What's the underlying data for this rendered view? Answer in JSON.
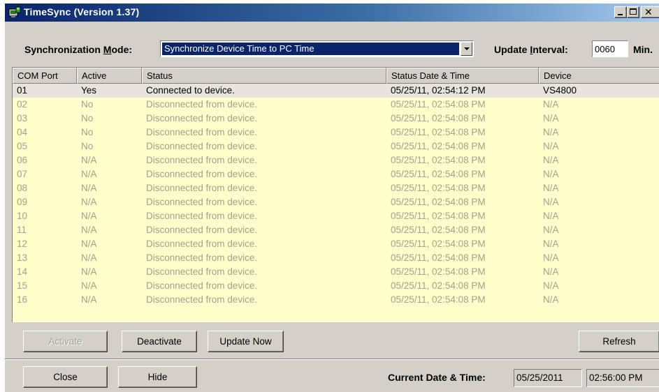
{
  "window": {
    "title": "TimeSync (Version 1.37)",
    "icon": "timesync-app-icon"
  },
  "sync_mode": {
    "label_prefix": "Synchronization ",
    "label_accel": "M",
    "label_suffix": "ode:",
    "value": "Synchronize Device Time to PC Time"
  },
  "update_interval": {
    "label_prefix": "Update ",
    "label_accel": "I",
    "label_suffix": "nterval:",
    "value": "0060",
    "unit": "Min."
  },
  "table": {
    "columns": [
      "COM Port",
      "Active",
      "Status",
      "Status Date & Time",
      "Device"
    ],
    "rows": [
      {
        "port": "01",
        "active": "Yes",
        "status": "Connected to device.",
        "datetime": "05/25/11, 02:54:12 PM",
        "device": "VS4800",
        "state": "active"
      },
      {
        "port": "02",
        "active": "No",
        "status": "Disconnected from device.",
        "datetime": "05/25/11, 02:54:08 PM",
        "device": "N/A",
        "state": "inactive"
      },
      {
        "port": "03",
        "active": "No",
        "status": "Disconnected from device.",
        "datetime": "05/25/11, 02:54:08 PM",
        "device": "N/A",
        "state": "inactive"
      },
      {
        "port": "04",
        "active": "No",
        "status": "Disconnected from device.",
        "datetime": "05/25/11, 02:54:08 PM",
        "device": "N/A",
        "state": "inactive"
      },
      {
        "port": "05",
        "active": "No",
        "status": "Disconnected from device.",
        "datetime": "05/25/11, 02:54:08 PM",
        "device": "N/A",
        "state": "inactive"
      },
      {
        "port": "06",
        "active": "N/A",
        "status": "Disconnected from device.",
        "datetime": "05/25/11, 02:54:08 PM",
        "device": "N/A",
        "state": "inactive"
      },
      {
        "port": "07",
        "active": "N/A",
        "status": "Disconnected from device.",
        "datetime": "05/25/11, 02:54:08 PM",
        "device": "N/A",
        "state": "inactive"
      },
      {
        "port": "08",
        "active": "N/A",
        "status": "Disconnected from device.",
        "datetime": "05/25/11, 02:54:08 PM",
        "device": "N/A",
        "state": "inactive"
      },
      {
        "port": "09",
        "active": "N/A",
        "status": "Disconnected from device.",
        "datetime": "05/25/11, 02:54:08 PM",
        "device": "N/A",
        "state": "inactive"
      },
      {
        "port": "10",
        "active": "N/A",
        "status": "Disconnected from device.",
        "datetime": "05/25/11, 02:54:08 PM",
        "device": "N/A",
        "state": "inactive"
      },
      {
        "port": "11",
        "active": "N/A",
        "status": "Disconnected from device.",
        "datetime": "05/25/11, 02:54:08 PM",
        "device": "N/A",
        "state": "inactive"
      },
      {
        "port": "12",
        "active": "N/A",
        "status": "Disconnected from device.",
        "datetime": "05/25/11, 02:54:08 PM",
        "device": "N/A",
        "state": "inactive"
      },
      {
        "port": "13",
        "active": "N/A",
        "status": "Disconnected from device.",
        "datetime": "05/25/11, 02:54:08 PM",
        "device": "N/A",
        "state": "inactive"
      },
      {
        "port": "14",
        "active": "N/A",
        "status": "Disconnected from device.",
        "datetime": "05/25/11, 02:54:08 PM",
        "device": "N/A",
        "state": "inactive"
      },
      {
        "port": "15",
        "active": "N/A",
        "status": "Disconnected from device.",
        "datetime": "05/25/11, 02:54:08 PM",
        "device": "N/A",
        "state": "inactive"
      },
      {
        "port": "16",
        "active": "N/A",
        "status": "Disconnected from device.",
        "datetime": "05/25/11, 02:54:08 PM",
        "device": "N/A",
        "state": "inactive"
      }
    ]
  },
  "buttons": {
    "activate": "Activate",
    "deactivate": "Deactivate",
    "update_now": "Update Now",
    "refresh": "Refresh",
    "close": "Close",
    "hide": "Hide"
  },
  "current": {
    "label": "Current Date & Time:",
    "date": "05/25/2011",
    "time": "02:56:00 PM"
  },
  "colors": {
    "titlebar": "#0a246a",
    "list_background": "#ffffcc",
    "inactive_text": "#a2a08e",
    "selection": "#0a246a"
  }
}
